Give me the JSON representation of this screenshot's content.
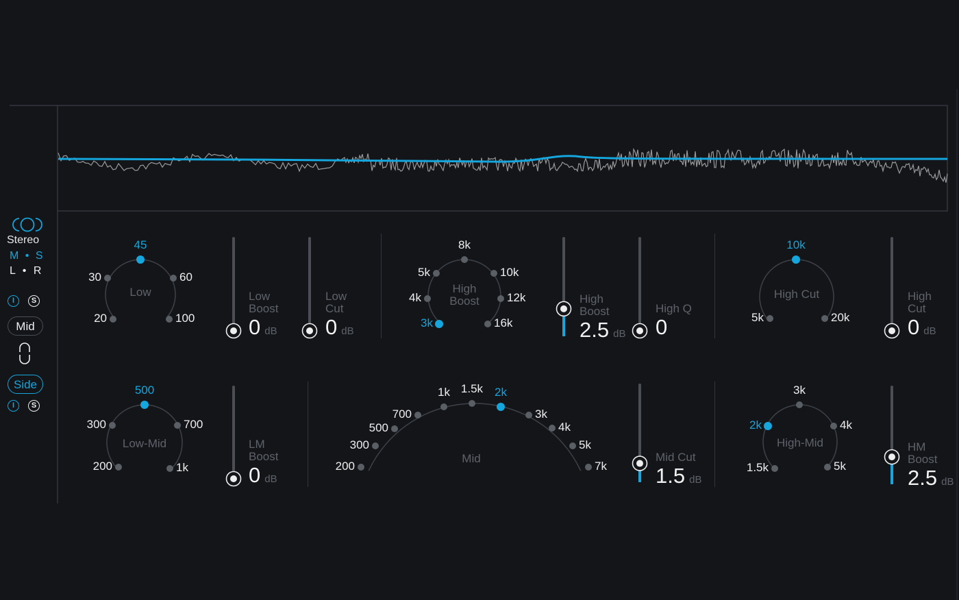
{
  "colors": {
    "accent": "#14a6dc",
    "background": "#131519",
    "dot": "#5a5f66",
    "track": "#4a4f56",
    "spectrum": "#9a9a9a"
  },
  "sidebar": {
    "stereo_icon": "stereo-link-icon",
    "stereo_label": "Stereo",
    "ms": {
      "m": "M",
      "dot": "•",
      "s": "S"
    },
    "lr": {
      "l": "L",
      "dot": "•",
      "r": "R"
    },
    "mid": {
      "label": "Mid",
      "power_icon": "power-icon",
      "solo_icon": "solo-icon",
      "solo_text": "S",
      "power_text": "I"
    },
    "link_icon": "link-icon",
    "side": {
      "label": "Side",
      "power_text": "I",
      "solo_text": "S"
    }
  },
  "selectors": [
    {
      "id": "low",
      "label": "Low",
      "options": [
        "20",
        "30",
        "45",
        "60",
        "100"
      ],
      "selected": "45"
    },
    {
      "id": "high-boost",
      "label": "High\nBoost",
      "options": [
        "3k",
        "4k",
        "5k",
        "8k",
        "10k",
        "12k",
        "16k"
      ],
      "selected": "3k"
    },
    {
      "id": "high-cut",
      "label": "High Cut",
      "options": [
        "5k",
        "10k",
        "20k"
      ],
      "selected": "10k"
    },
    {
      "id": "low-mid",
      "label": "Low-Mid",
      "options": [
        "200",
        "300",
        "500",
        "700",
        "1k"
      ],
      "selected": "500"
    },
    {
      "id": "mid",
      "label": "Mid",
      "options": [
        "200",
        "300",
        "500",
        "700",
        "1k",
        "1.5k",
        "2k",
        "3k",
        "4k",
        "5k",
        "7k"
      ],
      "selected": "2k"
    },
    {
      "id": "high-mid",
      "label": "High-Mid",
      "options": [
        "1.5k",
        "2k",
        "3k",
        "4k",
        "5k"
      ],
      "selected": "2k"
    }
  ],
  "sliders": [
    {
      "id": "low-boost",
      "label": "Low\nBoost",
      "value": "0",
      "unit": "dB",
      "level": 0
    },
    {
      "id": "low-cut",
      "label": "Low\nCut",
      "value": "0",
      "unit": "dB",
      "level": 0
    },
    {
      "id": "high-boost",
      "label": "High\nBoost",
      "value": "2.5",
      "unit": "dB",
      "level": 0.26
    },
    {
      "id": "high-q",
      "label": "High Q",
      "value": "0",
      "unit": "",
      "level": 0
    },
    {
      "id": "high-cut",
      "label": "High\nCut",
      "value": "0",
      "unit": "dB",
      "level": 0
    },
    {
      "id": "lm-boost",
      "label": "LM\nBoost",
      "value": "0",
      "unit": "dB",
      "level": 0
    },
    {
      "id": "mid-cut",
      "label": "Mid Cut",
      "value": "1.5",
      "unit": "dB",
      "level": 0.17
    },
    {
      "id": "hm-boost",
      "label": "HM\nBoost",
      "value": "2.5",
      "unit": "dB",
      "level": 0.26
    }
  ]
}
